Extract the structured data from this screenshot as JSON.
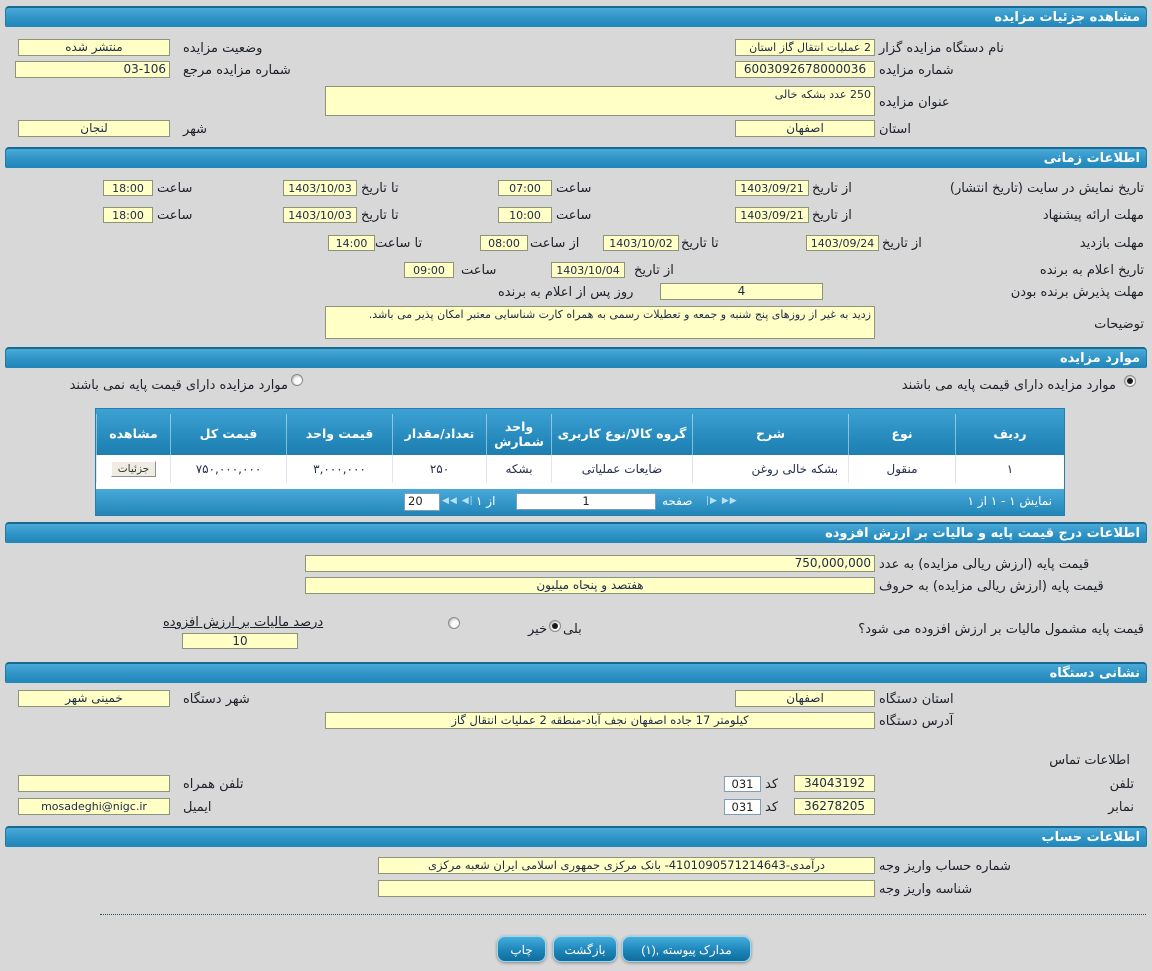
{
  "colors": {
    "accent": "#2e93c5",
    "field_bg": "#ffffc6",
    "bar_text": "#ffffff",
    "page_bg": "#d8d8d8"
  },
  "header": {
    "title": "مشاهده جزئیات مزایده"
  },
  "details": {
    "agency_label": "نام دستگاه مزایده گزار",
    "agency_value": "2 عملیات انتقال گاز استان",
    "status_label": "وضعیت مزایده",
    "status_value": "منتشر شده",
    "number_label": "شماره مزایده",
    "number_value": "6003092678000036",
    "ref_label": "شماره مزایده مرجع",
    "ref_value": "03-106",
    "title_label": "عنوان مزایده",
    "title_value": "250 عدد بشکه خالی",
    "province_label": "استان",
    "province_value": "اصفهان",
    "city_label": "شهر",
    "city_value": "لنجان"
  },
  "timing": {
    "section_title": "اطلاعات زمانی",
    "from_date_label": "از تاریخ",
    "to_date_label": "تا تاریخ",
    "hour_label": "ساعت",
    "from_hour_label": "از ساعت",
    "to_hour_label": "تا ساعت",
    "publish": {
      "label": "تاریخ نمایش در سایت (تاریخ انتشار)",
      "from_date": "1403/09/21",
      "from_time": "07:00",
      "to_date": "1403/10/03",
      "to_time": "18:00"
    },
    "offer": {
      "label": "مهلت ارائه پیشنهاد",
      "from_date": "1403/09/21",
      "from_time": "10:00",
      "to_date": "1403/10/03",
      "to_time": "18:00"
    },
    "visit": {
      "label": "مهلت بازدید",
      "from_date": "1403/09/24",
      "to_date": "1403/10/02",
      "from_time": "08:00",
      "to_time": "14:00"
    },
    "announce": {
      "label": "تاریخ اعلام به برنده",
      "from_date": "1403/10/04",
      "time": "09:00"
    },
    "accept": {
      "label": "مهلت پذیرش برنده بودن",
      "days": "4",
      "suffix": "روز پس از اعلام به برنده"
    },
    "notes_label": "توضیحات",
    "notes_value": "زدید به غیر از روزهای پنج شنبه و جمعه و تعطیلات رسمی به همراه کارت شناسایی معتبر امکان پذیر می باشد."
  },
  "items": {
    "section_title": "موارد مزایده",
    "radio_with_base": {
      "label": "موارد مزایده دارای قیمت پایه می باشند",
      "selected": true
    },
    "radio_without_base": {
      "label": "موارد مزایده دارای قیمت پایه نمی باشند",
      "selected": false
    },
    "table": {
      "headers": [
        "ردیف",
        "نوع",
        "شرح",
        "گروه کالا/نوع کاربری",
        "واحد شمارش",
        "تعداد/مقدار",
        "قیمت واحد",
        "قیمت کل",
        "مشاهده"
      ],
      "row": {
        "rank": "۱",
        "type": "منقول",
        "desc": "بشکه خالی روغن",
        "group": "ضایعات عملیاتی",
        "unit": "بشکه",
        "qty": "۲۵۰",
        "unit_price": "۳,۰۰۰,۰۰۰",
        "total": "۷۵۰,۰۰۰,۰۰۰",
        "view": "جزئیات"
      }
    },
    "pagination": {
      "summary": "نمایش ۱ - ۱ از ۱",
      "page_label": "صفحه",
      "page_value": "1",
      "of_label": "از ۱",
      "page_size": "20",
      "back_icons": "|◀ ◀◀",
      "fwd_icons": "▶▶ ▶|"
    }
  },
  "pricing": {
    "section_title": "اطلاعات درج قیمت پایه و مالیات بر ارزش افزوده",
    "numeric_label": "قیمت پایه (ارزش ریالی مزایده) به عدد",
    "numeric_value": "750,000,000",
    "words_label": "قیمت پایه (ارزش ریالی مزایده) به حروف",
    "words_value": "هفتصد و پنجاه میلیون",
    "vat_question": "قیمت پایه مشمول مالیات بر ارزش افزوده می شود؟",
    "yes_label": "بلی",
    "no_label": "خیر",
    "vat_selected": "بلی",
    "vat_percent_label": "درصد مالیات بر ارزش افزوده",
    "vat_percent_value": "10"
  },
  "address": {
    "section_title": "نشانی دستگاه",
    "province_label": "استان دستگاه",
    "province_value": "اصفهان",
    "city_label": "شهر دستگاه",
    "city_value": "خمینی شهر",
    "address_label": "آدرس دستگاه",
    "address_value": "کیلومتر 17 جاده اصفهان نجف آباد-منطقه 2 عملیات انتقال گاز",
    "contact_title": "اطلاعات تماس",
    "phone_label": "تلفن",
    "phone_value": "34043192",
    "code_label": "کد",
    "phone_code": "031",
    "mobile_label": "تلفن همراه",
    "mobile_value": "",
    "fax_label": "نمابر",
    "fax_value": "36278205",
    "fax_code": "031",
    "email_label": "ایمیل",
    "email_value": "mosadeghi@nigc.ir"
  },
  "account": {
    "section_title": "اطلاعات حساب",
    "number_label": "شماره حساب واریز وجه",
    "number_value": "درآمدی-4101090571214643- بانک مرکزی جمهوری اسلامی ایران شعبه مرکزی",
    "id_label": "شناسه واریز وجه",
    "id_value": ""
  },
  "actions": {
    "attachments": "مدارک پیوسته ,(۱)",
    "back": "بازگشت",
    "print": "چاپ"
  }
}
